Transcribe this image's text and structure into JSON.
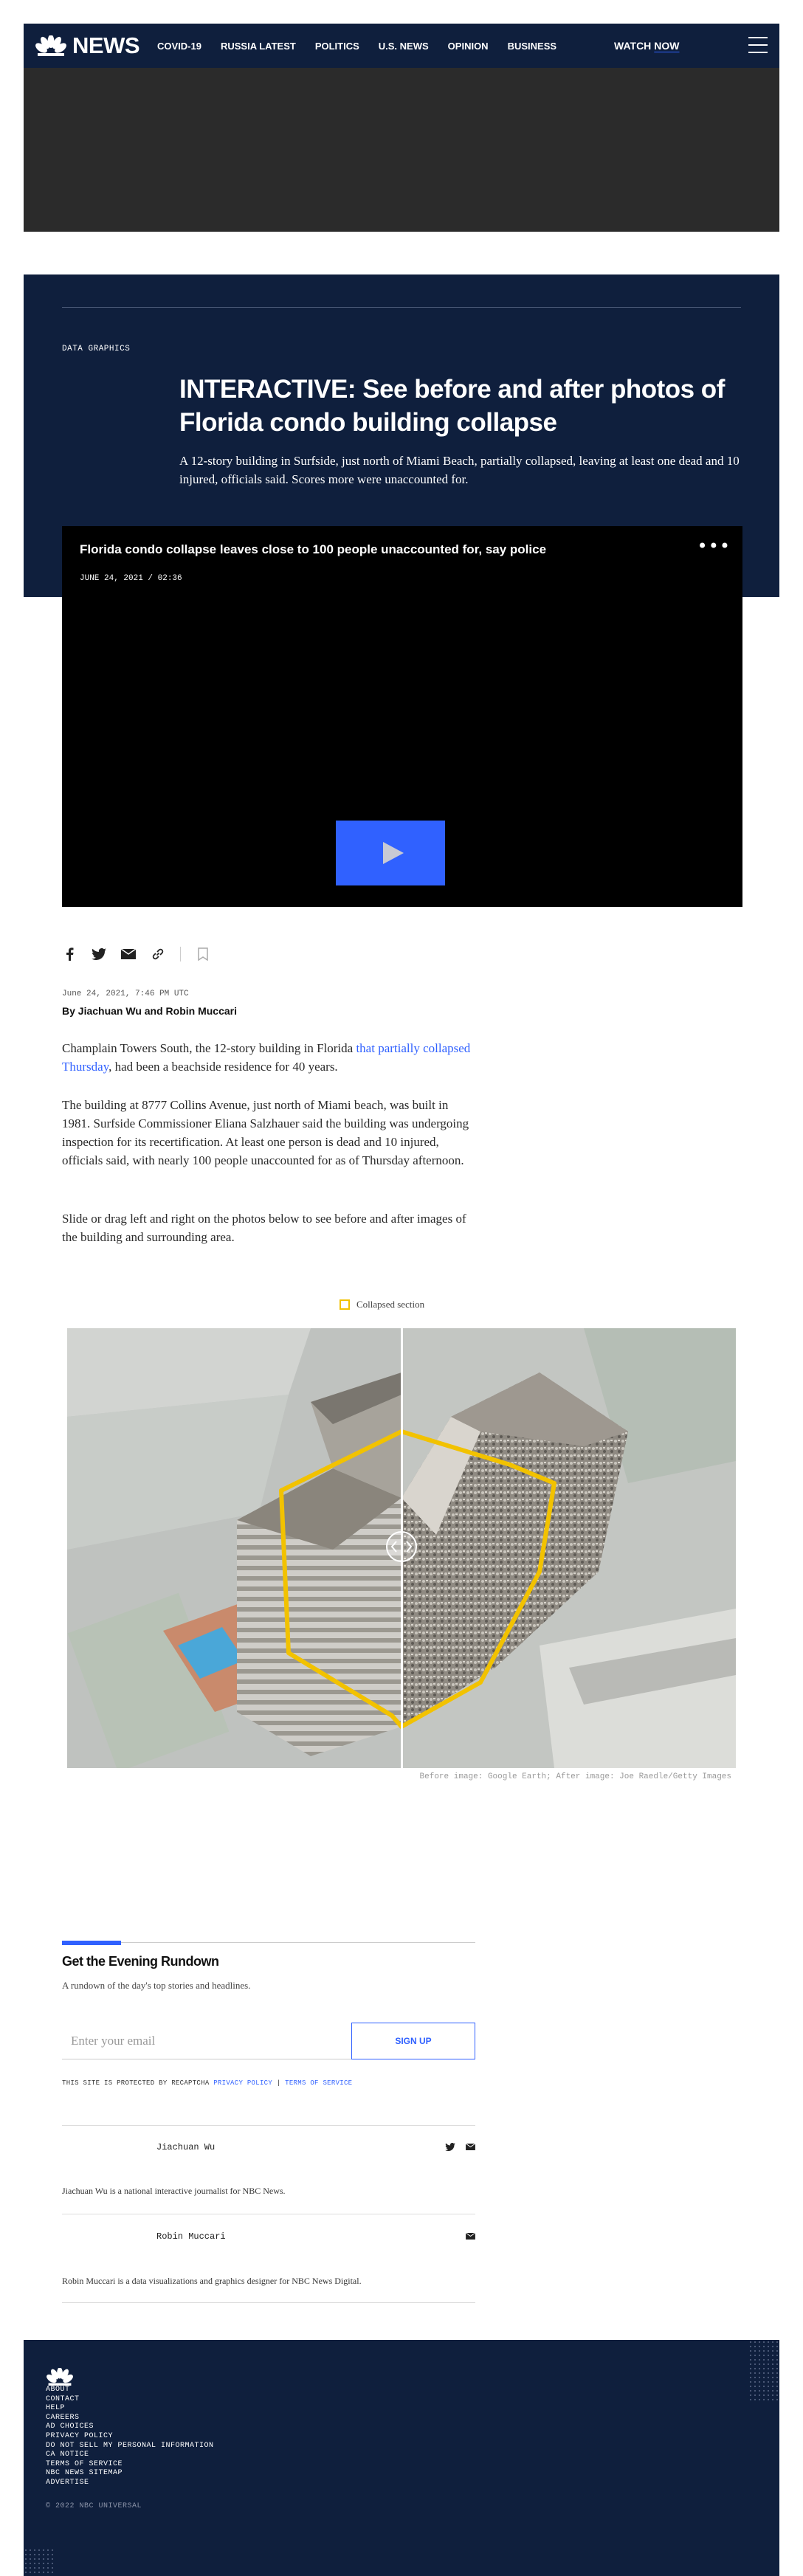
{
  "nav": {
    "logo_text": "NEWS",
    "links": [
      "COVID-19",
      "RUSSIA LATEST",
      "POLITICS",
      "U.S. NEWS",
      "OPINION",
      "BUSINESS"
    ],
    "watch_label": "WATCH",
    "watch_now": "NOW"
  },
  "hero": {
    "eyebrow": "DATA GRAPHICS",
    "headline": "INTERACTIVE: See before and after photos of Florida condo building collapse",
    "dek": "A 12-story building in Surfside, just north of Miami Beach, partially collapsed, leaving at least one dead and 10 injured, officials said. Scores more were unaccounted for."
  },
  "video": {
    "title": "Florida condo collapse leaves close to 100 people unaccounted for, say police",
    "date": "JUNE 24, 2021 / 02:36"
  },
  "article": {
    "date": "June 24, 2021, 7:46 PM UTC",
    "byline": "By Jiachuan Wu and Robin Muccari",
    "p1_before": "Champlain Towers South, the 12-story building in Florida ",
    "p1_link": "that partially collapsed Thursday",
    "p1_after": ", had been a beachside residence for 40 years.",
    "p2": "The building at 8777 Collins Avenue, just north of Miami beach, was built in 1981. Surfside Commissioner Eliana Salzhauer said the building was undergoing inspection for its recertification. At least one person is dead and 10 injured, officials said, with nearly 100 people unaccounted for as of Thursday afternoon.",
    "p3": "Slide or drag left and right on the photos below to see before and after images of the building and surrounding area."
  },
  "graphic": {
    "legend_label": "Collapsed section",
    "legend_color": "#f2c200",
    "credit": "Before image: Google Earth; After image: Joe Raedle/Getty Images"
  },
  "newsletter": {
    "title": "Get the Evening Rundown",
    "description": "A rundown of the day's top stories and headlines.",
    "email_placeholder": "Enter your email",
    "signup_label": "SIGN UP",
    "recaptcha_text": "THIS SITE IS PROTECTED BY RECAPTCHA ",
    "privacy_link": "PRIVACY POLICY",
    "separator": " | ",
    "terms_link": "TERMS OF SERVICE"
  },
  "authors": [
    {
      "name": "Jiachuan Wu",
      "bio": "Jiachuan Wu is a national interactive journalist for NBC News."
    },
    {
      "name": "Robin Muccari",
      "bio": "Robin Muccari is a data visualizations and graphics designer for NBC News Digital."
    }
  ],
  "footer": {
    "links": [
      "ABOUT",
      "CONTACT",
      "HELP",
      "CAREERS",
      "AD CHOICES",
      "PRIVACY POLICY",
      "DO NOT SELL MY PERSONAL INFORMATION",
      "CA NOTICE",
      "TERMS OF SERVICE",
      "NBC NEWS SITEMAP",
      "ADVERTISE"
    ],
    "copyright": "© 2022 NBC UNIVERSAL"
  },
  "colors": {
    "navy": "#0f1f3d",
    "accent_blue": "#3061ff"
  }
}
